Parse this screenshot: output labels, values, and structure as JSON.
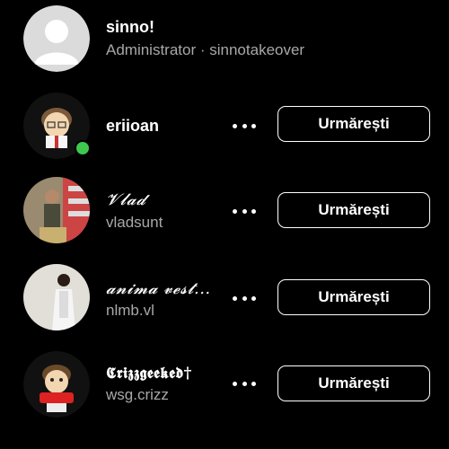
{
  "members": [
    {
      "name": "sinno!",
      "subtitle": "Administrator · sinnotakeover",
      "role_row": true
    },
    {
      "name": "eriioan",
      "subtitle": "",
      "online": true,
      "button_label": "Urmărești",
      "avatar_icon": "cartoon-avatar-icon"
    },
    {
      "name": "𝓥𝓵𝓪𝓭",
      "subtitle": "vladsunt",
      "button_label": "Urmărești",
      "avatar_icon": "photo-avatar-icon"
    },
    {
      "name": "𝓪𝓷𝓲𝓶𝓪 𝓿𝓮𝓼𝓽...",
      "subtitle": "nlmb.vl",
      "button_label": "Urmărești",
      "avatar_icon": "photo-avatar-icon"
    },
    {
      "name": "𝕮𝖗𝖎𝖟𝖟𝖌𝖊𝖊𝖐𝖊𝖉†",
      "subtitle": "wsg.crizz",
      "button_label": "Urmărești",
      "avatar_icon": "cartoon-avatar-icon"
    }
  ],
  "colors": {
    "background": "#000000",
    "secondary_text": "#a8a8a8",
    "online": "#3ec84f",
    "button_border": "#ffffff"
  }
}
